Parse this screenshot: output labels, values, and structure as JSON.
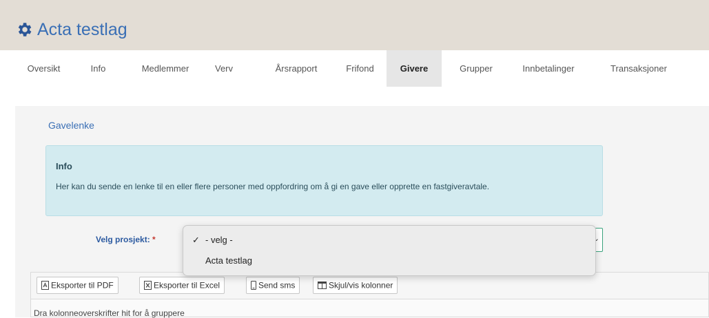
{
  "header": {
    "title": "Acta testlag",
    "icon": "gear-icon",
    "accent": "#3a6fb5"
  },
  "tabs": [
    {
      "label": "Oversikt",
      "active": false
    },
    {
      "label": "Info",
      "active": false
    },
    {
      "label": "Medlemmer",
      "active": false
    },
    {
      "label": "Verv",
      "active": false
    },
    {
      "label": "Årsrapport",
      "active": false
    },
    {
      "label": "Frifond",
      "active": false
    },
    {
      "label": "Givere",
      "active": true
    },
    {
      "label": "Grupper",
      "active": false
    },
    {
      "label": "Innbetalinger",
      "active": false
    },
    {
      "label": "Transaksjoner",
      "active": false
    }
  ],
  "section": {
    "title": "Gavelenke"
  },
  "info": {
    "title": "Info",
    "text": "Her kan du sende en lenke til en eller flere personer med oppfordring om å gi en gave eller opprette en fastgiveravtale."
  },
  "project_field": {
    "label": "Velg prosjekt:",
    "required_mark": "*",
    "selected": "- velg -",
    "options": [
      {
        "label": "- velg -",
        "checked": true
      },
      {
        "label": "Acta testlag",
        "checked": false
      }
    ]
  },
  "toolbar": {
    "export_pdf": "Eksporter til PDF",
    "export_excel": "Eksporter til Excel",
    "send_sms": "Send sms",
    "toggle_columns": "Skjul/vis kolonner"
  },
  "grid": {
    "group_hint": "Dra kolonneoverskrifter hit for å gruppere"
  }
}
